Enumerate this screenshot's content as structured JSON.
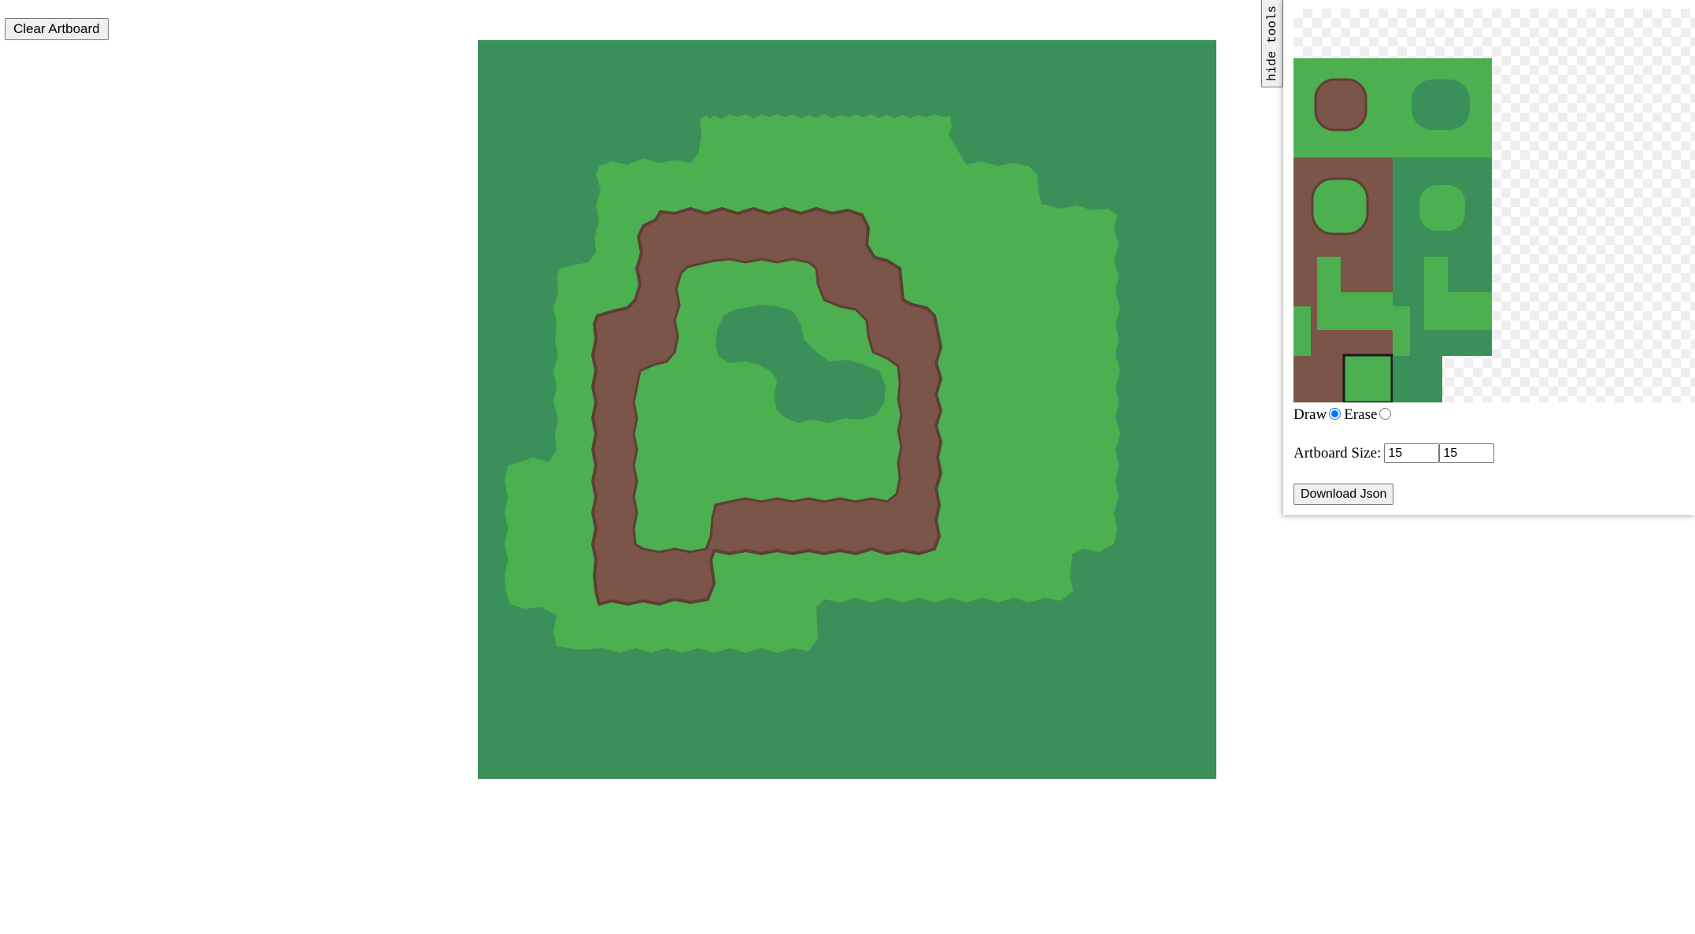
{
  "toolbar": {
    "clear_label": "Clear Artboard"
  },
  "tools": {
    "toggle_label": "hide tools",
    "mode": {
      "draw_label": "Draw",
      "erase_label": "Erase",
      "selected": "draw"
    },
    "artboard_size": {
      "label": "Artboard Size:",
      "width": "15",
      "height": "15"
    },
    "download_label": "Download Json"
  },
  "colors": {
    "dark_grass": "#3a9058",
    "grass": "#4caf50",
    "dirt": "#7a5548",
    "dirt_edge": "#5e3f35",
    "selection": "#1a1a1a"
  },
  "artboard": {
    "columns": 15,
    "rows": 15
  },
  "tileset": {
    "selected_tile": "grass-fill"
  }
}
